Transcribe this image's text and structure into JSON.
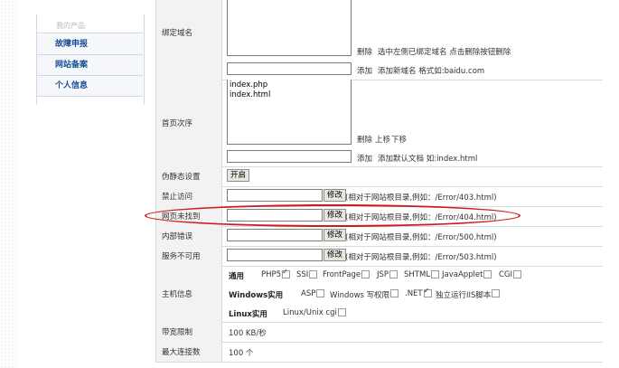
{
  "sidebar": {
    "top_label": "我的产品",
    "items": [
      {
        "label": "故障申报"
      },
      {
        "label": "网站备案"
      },
      {
        "label": "个人信息"
      }
    ]
  },
  "rows": {
    "bind_domain": {
      "label": "绑定域名",
      "delete_link": "删除",
      "delete_hint": "选中左侧已绑定域名 点击删除按钮删除",
      "add_link": "添加",
      "add_hint": "添加新域名 格式如:baidu.com"
    },
    "index_order": {
      "label": "首页次序",
      "list": "index.php\nindex.html",
      "delete_link": "删除",
      "up_link": "上移",
      "down_link": "下移",
      "add_link": "添加",
      "add_hint": "添加默认文档 如:index.html"
    },
    "rewrite": {
      "label": "伪静态设置",
      "button": "开启"
    },
    "forbidden": {
      "label": "禁止访问",
      "button": "修改",
      "hint": "(相对于网站根目录,例如：/Error/403.html)"
    },
    "not_found": {
      "label": "网页未找到",
      "button": "修改",
      "hint": "(相对于网站根目录,例如：/Error/404.html)"
    },
    "internal_error": {
      "label": "内部错误",
      "button": "修改",
      "hint": "(相对于网站根目录,例如：/Error/500.html)"
    },
    "unavailable": {
      "label": "服务不可用",
      "button": "修改",
      "hint": "(相对于网站根目录,例如：/Error/503.html)"
    },
    "host_info": {
      "label": "主机信息",
      "general": "通用",
      "php5": "PHP5",
      "ssi": "SSI",
      "frontpage": "FrontPage",
      "jsp": "JSP",
      "shtml": "SHTML",
      "javaapplet": "JavaApplet",
      "cgi": "CGI",
      "windows": "Windows实用",
      "asp": "ASP",
      "win_write": "Windows 写权限",
      "net": ".NET",
      "iis": "独立运行IIS脚本",
      "linux": "Linux实用",
      "linux_cgi": "Linux/Unix cgi"
    },
    "bandwidth": {
      "label": "带宽限制",
      "value": "100 KB/秒"
    },
    "max_conn": {
      "label": "最大连接数",
      "value": "100 个"
    }
  },
  "colors": {
    "highlight": "#cc1b1b",
    "link": "#164f95"
  }
}
